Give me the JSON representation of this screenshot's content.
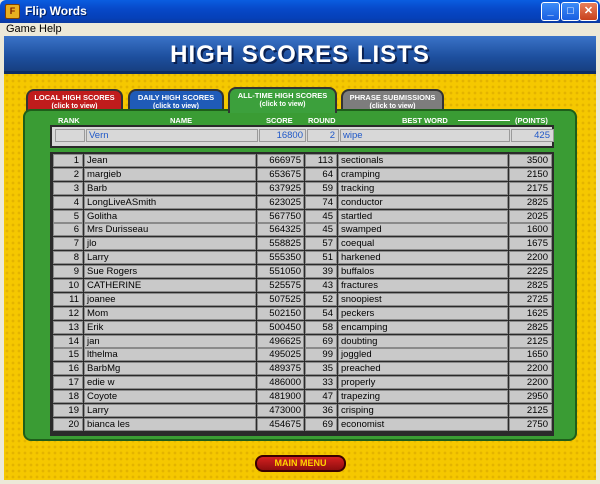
{
  "window": {
    "title": "Flip Words",
    "controls": {
      "minimize": "_",
      "maximize": "□",
      "close": "✕"
    }
  },
  "menu": [
    "Game",
    "Help"
  ],
  "banner": "HIGH SCORES LISTS",
  "tabs": [
    {
      "label": "LOCAL HIGH SCORES",
      "sub": "(click to view)"
    },
    {
      "label": "DAILY HIGH SCORES",
      "sub": "(click to view)"
    },
    {
      "label": "ALL-TIME HIGH SCORES",
      "sub": "(click to view)"
    },
    {
      "label": "PHRASE SUBMISSIONS",
      "sub": "(click to view)"
    }
  ],
  "headers": {
    "rank": "RANK",
    "name": "NAME",
    "score": "SCORE",
    "round": "ROUND",
    "word": "BEST WORD",
    "points": "(POINTS)"
  },
  "player": {
    "rank": "",
    "name": "Vern",
    "score": "16800",
    "round": "2",
    "word": "wipe",
    "points": "425"
  },
  "rows": [
    {
      "rank": "1",
      "name": "Jean",
      "score": "666975",
      "round": "113",
      "word": "sectionals",
      "points": "3500"
    },
    {
      "rank": "2",
      "name": "margieb",
      "score": "653675",
      "round": "64",
      "word": "cramping",
      "points": "2150"
    },
    {
      "rank": "3",
      "name": "Barb",
      "score": "637925",
      "round": "59",
      "word": "tracking",
      "points": "2175"
    },
    {
      "rank": "4",
      "name": "LongLiveASmith",
      "score": "623025",
      "round": "74",
      "word": "conductor",
      "points": "2825"
    },
    {
      "rank": "5",
      "name": "Golitha",
      "score": "567750",
      "round": "45",
      "word": "startled",
      "points": "2025"
    },
    {
      "rank": "6",
      "name": "Mrs Durisseau",
      "score": "564325",
      "round": "45",
      "word": "swamped",
      "points": "1600"
    },
    {
      "rank": "7",
      "name": "jlo",
      "score": "558825",
      "round": "57",
      "word": "coequal",
      "points": "1675"
    },
    {
      "rank": "8",
      "name": "Larry",
      "score": "555350",
      "round": "51",
      "word": "harkened",
      "points": "2200"
    },
    {
      "rank": "9",
      "name": "Sue Rogers",
      "score": "551050",
      "round": "39",
      "word": "buffalos",
      "points": "2225"
    },
    {
      "rank": "10",
      "name": "CATHERINE",
      "score": "525575",
      "round": "43",
      "word": "fractures",
      "points": "2825"
    },
    {
      "rank": "11",
      "name": "joanee",
      "score": "507525",
      "round": "52",
      "word": "snoopiest",
      "points": "2725"
    },
    {
      "rank": "12",
      "name": "Mom",
      "score": "502150",
      "round": "54",
      "word": "peckers",
      "points": "1625"
    },
    {
      "rank": "13",
      "name": "Erik",
      "score": "500450",
      "round": "58",
      "word": "encamping",
      "points": "2825"
    },
    {
      "rank": "14",
      "name": "jan",
      "score": "496625",
      "round": "69",
      "word": "doubting",
      "points": "2125"
    },
    {
      "rank": "15",
      "name": "lthelma",
      "score": "495025",
      "round": "99",
      "word": "joggled",
      "points": "1650"
    },
    {
      "rank": "16",
      "name": "BarbMg",
      "score": "489375",
      "round": "35",
      "word": "preached",
      "points": "2200"
    },
    {
      "rank": "17",
      "name": "edie w",
      "score": "486000",
      "round": "33",
      "word": "properly",
      "points": "2200"
    },
    {
      "rank": "18",
      "name": "Coyote",
      "score": "481900",
      "round": "47",
      "word": "trapezing",
      "points": "2950"
    },
    {
      "rank": "19",
      "name": "Larry",
      "score": "473000",
      "round": "36",
      "word": "crisping",
      "points": "2125"
    },
    {
      "rank": "20",
      "name": "bianca les",
      "score": "454675",
      "round": "69",
      "word": "economist",
      "points": "2750"
    }
  ],
  "main_menu": "MAIN MENU",
  "colors": {
    "banner": "#1d4f9e",
    "board": "#3a9c34",
    "background": "#f5c800",
    "player_text": "#1f58c8"
  }
}
